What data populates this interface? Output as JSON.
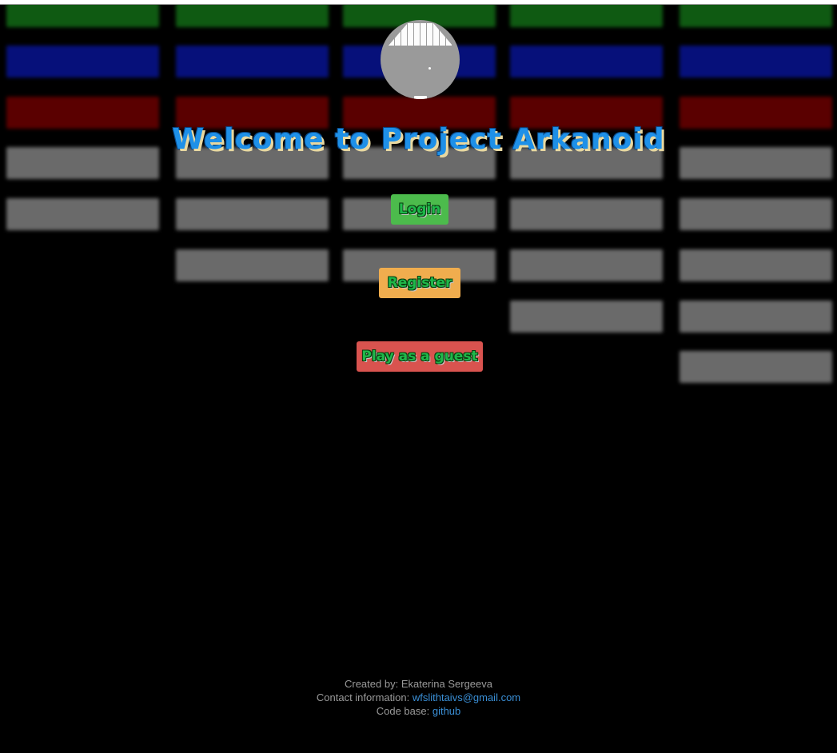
{
  "title": "Welcome to Project Arkanoid",
  "buttons": {
    "login": "Login",
    "register": "Register",
    "guest": "Play as a guest"
  },
  "footer": {
    "created_label": "Created by:",
    "created_value": "Ekaterina Sergeeva",
    "contact_label": "Contact information:",
    "contact_value": "wfslithtaivs@gmail.com",
    "code_label": "Code base:",
    "code_value": "github"
  },
  "colors": {
    "background": "#000000",
    "brick_green": "#0f5a12",
    "brick_blue": "#06107a",
    "brick_red": "#5a0000",
    "brick_gray": "#6a6a6a",
    "title": "#1e90e8",
    "login_button": "#4cbb4c",
    "register_button": "#f0ad4e",
    "guest_button": "#d9534f",
    "link": "#3a8fd6"
  },
  "icons": {
    "logo": "arkanoid-logo-icon"
  }
}
